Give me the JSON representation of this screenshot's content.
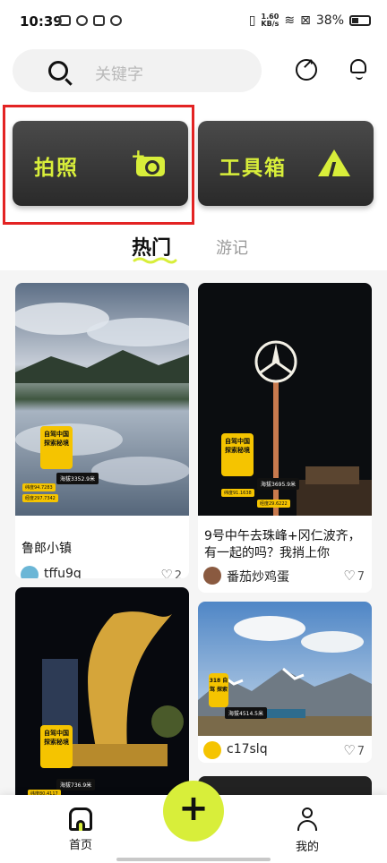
{
  "status": {
    "time": "10:39",
    "net_speed_top": "1.60",
    "net_speed_bottom": "KB/s",
    "battery": "38%"
  },
  "search": {
    "placeholder": "关键字"
  },
  "header_icons": [
    "share-icon",
    "bell-icon"
  ],
  "actions": [
    {
      "label": "拍照",
      "icon": "camera-plus-icon"
    },
    {
      "label": "工具箱",
      "icon": "mountain-icon"
    }
  ],
  "tabs": [
    {
      "label": "热门",
      "active": true
    },
    {
      "label": "游记",
      "active": false
    }
  ],
  "posts": [
    {
      "title": "鲁郎小镇",
      "author": "tffu9q",
      "likes": "2",
      "badge": "自驾中国 探索秘境",
      "altitude": "海拔3352.9米",
      "chip1": "纬度94.7283",
      "chip2": "经度297.7342"
    },
    {
      "title": "9号中午去珠峰+冈仁波齐，有一起的吗？我捎上你",
      "author": "番茄炒鸡蛋",
      "likes": "7",
      "badge": "自驾中国 探索秘境",
      "altitude": "海拔3695.9米",
      "chip1": "纬度91.1638",
      "chip2": "经度29.6222"
    },
    {
      "title": "",
      "author": "",
      "likes": "",
      "badge": "自驾中国 探索秘境",
      "altitude": "海拔736.9米",
      "chip1": "纬度80.4117",
      "chip2": ""
    },
    {
      "title": "",
      "author": "c17slq",
      "likes": "7",
      "badge": "318 自驾 探索",
      "altitude": "海拔4514.5米",
      "chip1": "",
      "chip2": ""
    }
  ],
  "nav": {
    "home": "首页",
    "add": "+",
    "mine": "我的"
  },
  "colors": {
    "accent": "#d8ee3a",
    "card_dark": "#333333",
    "highlight": "#e32323"
  }
}
